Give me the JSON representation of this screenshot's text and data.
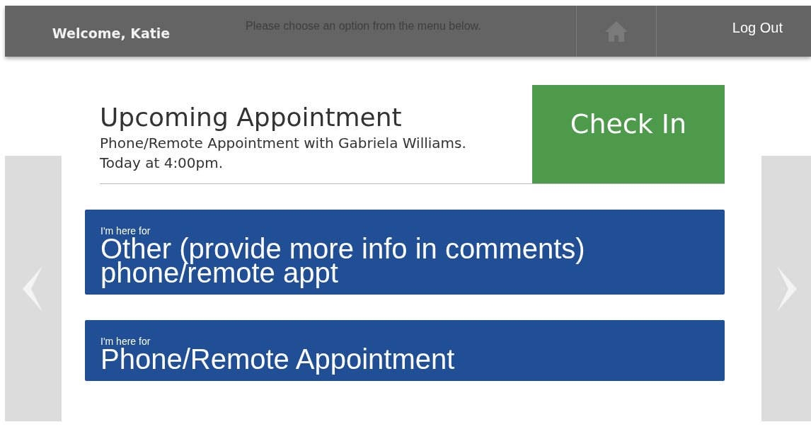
{
  "header": {
    "welcome": "Welcome, Katie",
    "message": "Please choose an option from the menu below.",
    "logout": "Log Out"
  },
  "appointment": {
    "title": "Upcoming Appointment",
    "detail": "Phone/Remote Appointment with Gabriela Williams.",
    "time": "Today at 4:00pm.",
    "button": "Check In"
  },
  "options": [
    {
      "prefix": "I'm here for",
      "label": "Other (provide more info in comments) phone/remote appt"
    },
    {
      "prefix": "I'm here for",
      "label": "Phone/Remote Appointment"
    }
  ]
}
